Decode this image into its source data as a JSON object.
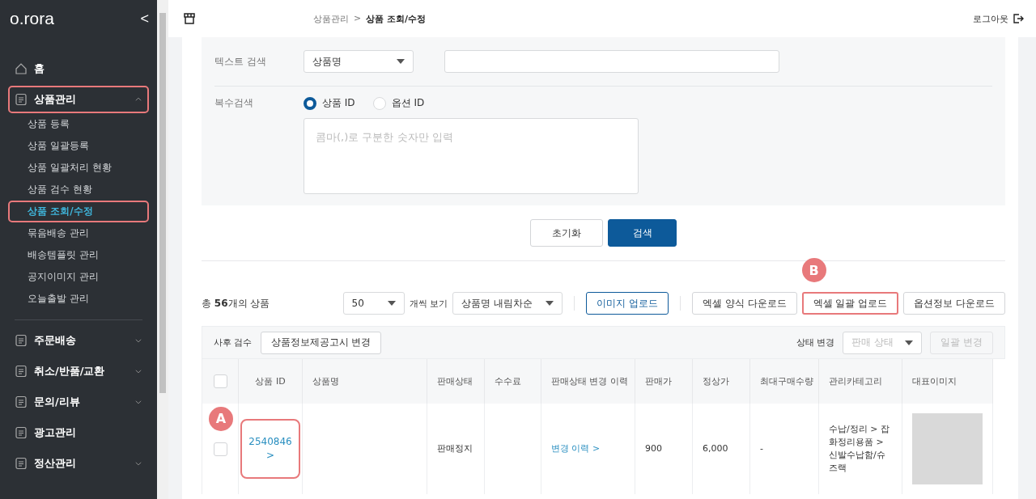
{
  "sidebar": {
    "logo": "o.rora",
    "collapse": "<",
    "items": [
      {
        "label": "홈",
        "highlighted": false
      },
      {
        "label": "상품관리",
        "expanded": true,
        "highlighted": true,
        "children": [
          {
            "label": "상품 등록",
            "selected": false,
            "highlighted": false
          },
          {
            "label": "상품 일괄등록",
            "selected": false,
            "highlighted": false
          },
          {
            "label": "상품 일괄처리 현황",
            "selected": false,
            "highlighted": false
          },
          {
            "label": "상품 검수 현황",
            "selected": false,
            "highlighted": false
          },
          {
            "label": "상품 조회/수정",
            "selected": true,
            "highlighted": true
          },
          {
            "label": "묶음배송 관리",
            "selected": false,
            "highlighted": false
          },
          {
            "label": "배송템플릿 관리",
            "selected": false,
            "highlighted": false
          },
          {
            "label": "공지이미지 관리",
            "selected": false,
            "highlighted": false
          },
          {
            "label": "오늘출발 관리",
            "selected": false,
            "highlighted": false
          }
        ]
      },
      {
        "label": "주문배송",
        "expanded": false,
        "highlighted": false
      },
      {
        "label": "취소/반품/교환",
        "expanded": false,
        "highlighted": false
      },
      {
        "label": "문의/리뷰",
        "expanded": false,
        "highlighted": false
      },
      {
        "label": "광고관리",
        "highlighted": false
      },
      {
        "label": "정산관리",
        "expanded": false,
        "highlighted": false
      }
    ]
  },
  "header": {
    "breadcrumb": [
      "상품관리",
      "상품 조회/수정"
    ],
    "breadcrumb_separator": ">",
    "logout": "로그아웃"
  },
  "search": {
    "text_label": "텍스트 검색",
    "text_select": "상품명",
    "multi_label": "복수검색",
    "radios": [
      {
        "label": "상품 ID",
        "selected": true
      },
      {
        "label": "옵션 ID",
        "selected": false
      }
    ],
    "placeholder": "콤마(,)로 구분한 숫자만 입력",
    "reset": "초기화",
    "submit": "검색"
  },
  "results": {
    "total": "총 **56**개의 상품",
    "page_size": "50",
    "page_size_label": "개씩 보기",
    "sort": "상품명 내림차순",
    "buttons": [
      {
        "label": "이미지 업로드",
        "kind": "primary"
      },
      {
        "label": "엑셀 양식 다운로드",
        "kind": "plain"
      },
      {
        "label": "엑셀 일괄 업로드",
        "kind": "plain",
        "badge": "B"
      },
      {
        "label": "옵션정보 다운로드",
        "kind": "plain"
      }
    ]
  },
  "table": {
    "review_label": "사후 검수",
    "notice_button": "상품정보제공고시 변경",
    "status_label": "상태 변경",
    "status_select": "판매 상태",
    "bulk_button": "일괄 변경",
    "bulk_disabled": true,
    "all_checked": false,
    "columns": [
      "상품 ID",
      "상품명",
      "판매상태",
      "수수료",
      "판매상태 변경 이력",
      "판매가",
      "정상가",
      "최대구매수량",
      "관리카테고리",
      "대표이미지"
    ],
    "rows": [
      {
        "checked": false,
        "id": "2540846",
        "id_arrow": ">",
        "id_badge": "A",
        "status": "판매정지",
        "history": "변경 이력",
        "history_arrow": ">",
        "price": "900",
        "list_price": "6,000",
        "max_qty": "-",
        "category": "수납/정리 > 잡화정리용품 > 신발수납함/슈즈랙"
      }
    ]
  }
}
